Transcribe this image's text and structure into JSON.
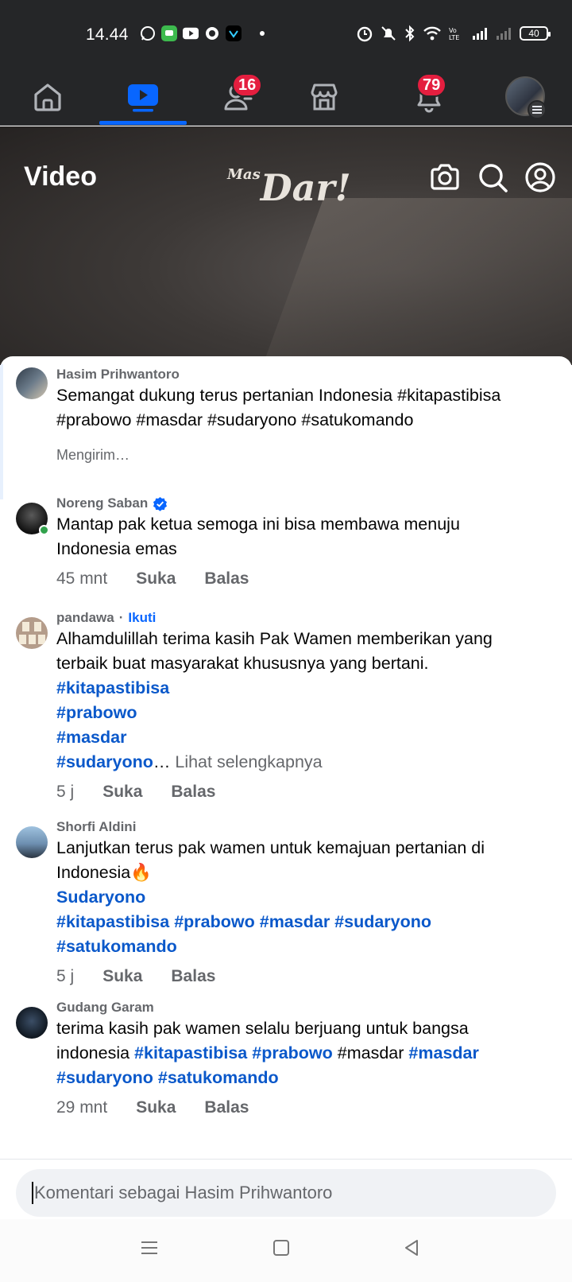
{
  "status_bar": {
    "time": "14.44",
    "battery": "40"
  },
  "nav": {
    "friends_badge": "16",
    "notifications_badge": "79"
  },
  "video": {
    "title": "Video",
    "logo_small": "Mas",
    "logo_big": "Dar!"
  },
  "comments": [
    {
      "name": "Hasim Prihwantoro",
      "text": "Semangat dukung terus pertanian Indonesia #kitapastibisa #prabowo #masdar #sudaryono #satukomando",
      "status": "Mengirim…"
    },
    {
      "name": "Noreng Saban",
      "text": "Mantap pak ketua semoga ini bisa membawa menuju Indonesia emas",
      "time": "45 mnt",
      "like": "Suka",
      "reply": "Balas"
    },
    {
      "name": "pandawa",
      "follow": "Ikuti",
      "text": "Alhamdulillah terima kasih Pak Wamen memberikan yang terbaik buat masyarakat khususnya yang bertani.",
      "tags": [
        "#kitapastibisa",
        "#prabowo",
        "#masdar",
        "#sudaryono"
      ],
      "ellipsis": "…",
      "see_more": "Lihat selengkapnya",
      "time": "5 j",
      "like": "Suka",
      "reply": "Balas"
    },
    {
      "name": "Shorfi Aldini",
      "text": "Lanjutkan terus pak wamen untuk kemajuan pertanian di Indonesia🔥",
      "mention": "Sudaryono",
      "tags": [
        "#kitapastibisa",
        "#prabowo",
        "#masdar",
        "#sudaryono",
        "#satukomando"
      ],
      "time": "5 j",
      "like": "Suka",
      "reply": "Balas"
    },
    {
      "name": "Gudang Garam",
      "text_start": "terima kasih pak wamen selalu berjuang untuk bangsa indonesia",
      "tag1": "#kitapastibisa",
      "tag2": "#prabowo",
      "plain": "#masdar",
      "tag3": "#masdar",
      "tag4": "#sudaryono",
      "tag5": "#satukomando",
      "time": "29 mnt",
      "like": "Suka",
      "reply": "Balas"
    }
  ],
  "composer": {
    "placeholder": "Komentari sebagai Hasim Prihwantoro"
  },
  "colors": {
    "topbar": "#252628",
    "accent": "#0866ff",
    "badge": "#e41e3f",
    "hashtag": "#0a58ca"
  }
}
